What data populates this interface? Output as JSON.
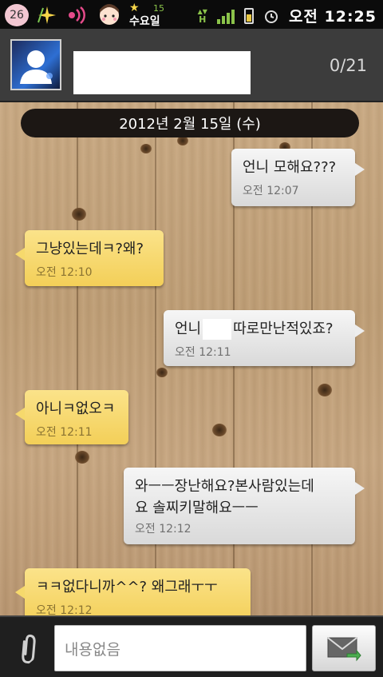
{
  "status_bar": {
    "date_badge": "26",
    "weekday_sticker": "수요일",
    "sticker_number": "15",
    "network_indicator": "H",
    "clock": "오전 12:25"
  },
  "header": {
    "contact_name": "",
    "char_counter": "0/21"
  },
  "chat": {
    "date_divider": "2012년 2월 15일 (수)",
    "messages": [
      {
        "direction": "outgoing",
        "text": "언니 모해요???",
        "time": "오전 12:07"
      },
      {
        "direction": "incoming",
        "text": "그냥있는데ㅋ?왜?",
        "time": "오전 12:10"
      },
      {
        "direction": "outgoing",
        "text_before": "언니",
        "text_after": "따로만난적있죠?",
        "time": "오전 12:11"
      },
      {
        "direction": "incoming",
        "text": "아니ㅋ없오ㅋ",
        "time": "오전 12:11"
      },
      {
        "direction": "outgoing",
        "text_line1": "와ㅡㅡ장난해요?본사람있는데",
        "text_line2": "요 솔찌키말해요ㅡㅡ",
        "time": "오전 12:12"
      },
      {
        "direction": "incoming",
        "text": "ㅋㅋ없다니까^^? 왜그래ㅜㅜ",
        "time": "오전 12:12"
      }
    ]
  },
  "composer": {
    "placeholder": "내용없음",
    "attach_icon": "paperclip-icon",
    "send_icon": "envelope-send-icon"
  },
  "colors": {
    "incoming_bubble": "#f5d460",
    "outgoing_bubble": "#e6e6e6",
    "date_pill": "#1c1714"
  }
}
